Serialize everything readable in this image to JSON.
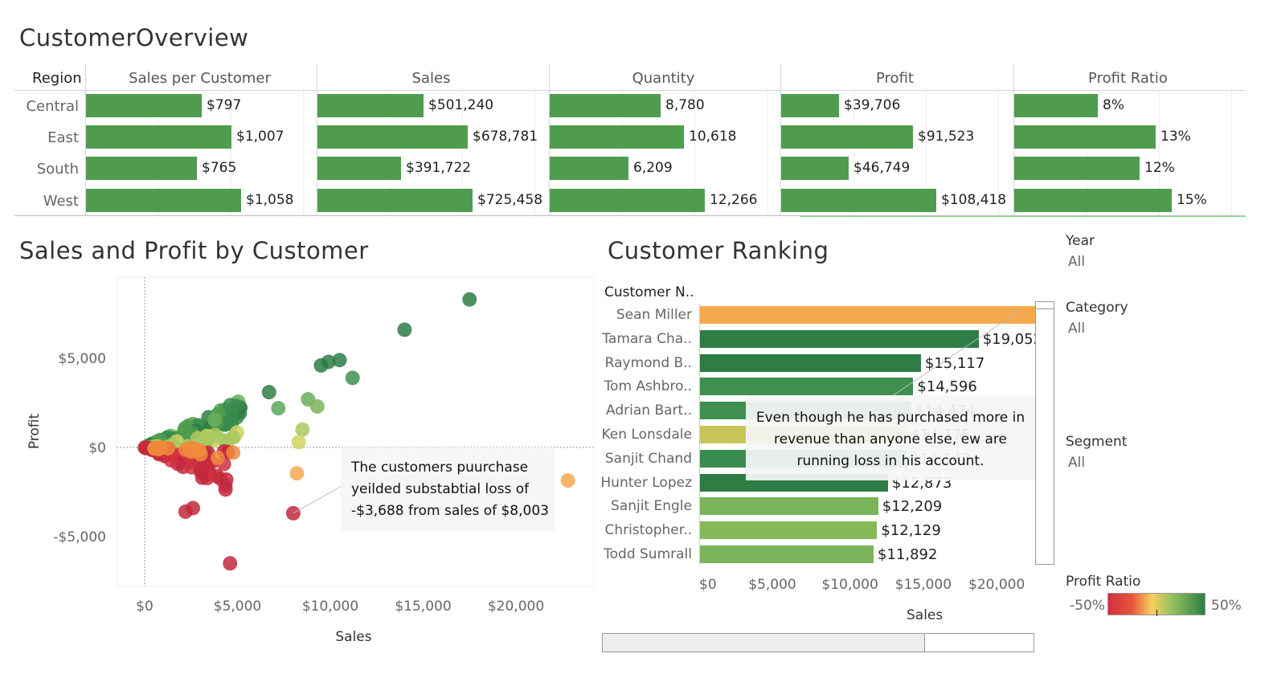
{
  "overview": {
    "title": "CustomerOverview",
    "region_header": "Region",
    "columns": [
      "Sales per Customer",
      "Sales",
      "Quantity",
      "Profit",
      "Profit Ratio"
    ],
    "regions": [
      "Central",
      "East",
      "South",
      "West"
    ],
    "values": [
      [
        "$797",
        "$501,240",
        "8,780",
        "$39,706",
        "8%"
      ],
      [
        "$1,007",
        "$678,781",
        "10,618",
        "$91,523",
        "13%"
      ],
      [
        "$765",
        "$391,722",
        "6,209",
        "$46,749",
        "12%"
      ],
      [
        "$1,058",
        "$725,458",
        "12,266",
        "$108,418",
        "15%"
      ]
    ],
    "bar_fractions": [
      [
        0.5,
        0.46,
        0.48,
        0.25,
        0.36
      ],
      [
        0.63,
        0.65,
        0.58,
        0.57,
        0.61
      ],
      [
        0.48,
        0.36,
        0.34,
        0.29,
        0.54
      ],
      [
        0.67,
        0.67,
        0.67,
        0.67,
        0.68
      ]
    ],
    "bar_color": "#4f9c4f"
  },
  "scatter": {
    "title": "Sales and Profit by Customer",
    "xlabel": "Sales",
    "ylabel": "Profit",
    "xticks": [
      "$0",
      "$5,000",
      "$10,000",
      "$15,000",
      "$20,000"
    ],
    "yticks": [
      "$5,000",
      "$0",
      "-$5,000"
    ],
    "annotation": [
      "The customers puurchase",
      "yeilded substabtial loss of",
      "-$3,688 from sales of $8,003"
    ]
  },
  "ranking": {
    "title": "Customer Ranking",
    "header": "Customer N..",
    "xlabel": "Sales",
    "xticks": [
      "$0",
      "$5,000",
      "$10,000",
      "$15,000",
      "$20,000"
    ],
    "rows": [
      {
        "name": "Sean Miller",
        "label": "",
        "value": 25043,
        "color": "#f5a94f"
      },
      {
        "name": "Tamara Cha..",
        "label": "$19,052",
        "value": 19052,
        "color": "#2e7d45"
      },
      {
        "name": "Raymond B..",
        "label": "$15,117",
        "value": 15117,
        "color": "#2e7d45"
      },
      {
        "name": "Tom Ashbro..",
        "label": "$14,596",
        "value": 14596,
        "color": "#3f8f50"
      },
      {
        "name": "Adrian Bart..",
        "label": "$14,474",
        "value": 14474,
        "color": "#3f8f50"
      },
      {
        "name": "Ken Lonsdale",
        "label": "$14,175",
        "value": 14175,
        "color": "#c7c55a"
      },
      {
        "name": "Sanjit Chand",
        "label": "$14,142",
        "value": 14142,
        "color": "#3a8c4e"
      },
      {
        "name": "Hunter Lopez",
        "label": "$12,873",
        "value": 12873,
        "color": "#2e7d45"
      },
      {
        "name": "Sanjit Engle",
        "label": "$12,209",
        "value": 12209,
        "color": "#7ab55c"
      },
      {
        "name": "Christopher..",
        "label": "$12,129",
        "value": 12129,
        "color": "#86b95a"
      },
      {
        "name": "Todd Sumrall",
        "label": "$11,892",
        "value": 11892,
        "color": "#7ab55c"
      }
    ],
    "annotation": [
      "Even though he has purchased more in",
      "revenue than anyone else, ew are",
      "running loss in his account."
    ]
  },
  "filters": {
    "year": {
      "title": "Year",
      "value": "All"
    },
    "category": {
      "title": "Category",
      "value": "All"
    },
    "segment": {
      "title": "Segment",
      "value": "All"
    },
    "profit_ratio": {
      "title": "Profit Ratio",
      "min": "-50%",
      "max": "50%"
    }
  },
  "colors": {
    "positive": "#2e7d45",
    "neutral": "#f5d55a",
    "negative": "#d0303f"
  }
}
